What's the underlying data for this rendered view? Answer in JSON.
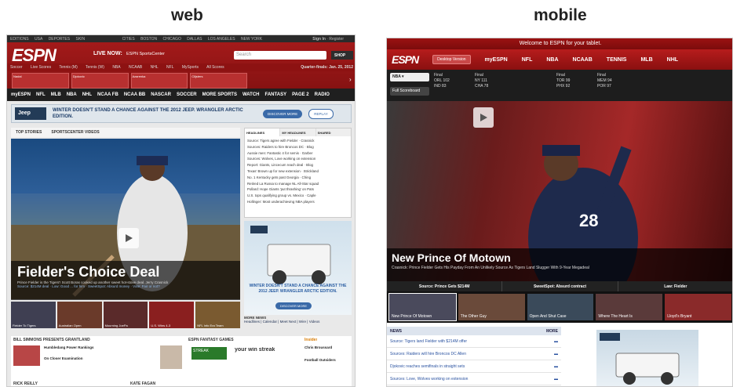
{
  "labels": {
    "web": "web",
    "mobile": "mobile"
  },
  "web": {
    "topbar": [
      "EDITIONS",
      "USA",
      "DEPORTES",
      "SKIN",
      "CITIES",
      "BOSTON",
      "CHICAGO",
      "DALLAS",
      "LOS ANGELES",
      "NEW YORK"
    ],
    "signin": "Sign In",
    "register": "Register",
    "logo": "ESPN",
    "live_now": "LIVE NOW:",
    "live_now_channel": "ESPN SportsCenter",
    "search_placeholder": "Search",
    "shop": "SHOP",
    "sports_nav": [
      "Soccer",
      "Live Scores",
      "Tennis (M)",
      "Tennis (W)",
      "NBA",
      "NCAAB",
      "NHL",
      "NFL",
      "MySports",
      "All Scores"
    ],
    "date": "Quarter-finals: Jan. 25, 2012",
    "score_cards": [
      "Nadal",
      "Djokovic",
      "Azarenka",
      "Clijsters"
    ],
    "main_nav": [
      "myESPN",
      "NFL",
      "MLB",
      "NBA",
      "NHL",
      "NCAA FB",
      "NCAA BB",
      "NASCAR",
      "SOCCER",
      "MORE SPORTS",
      "WATCH",
      "FANTASY",
      "PAGE 2",
      "RADIO"
    ],
    "ad": {
      "headline": "WINTER DOESN'T STAND A CHANCE AGAINST THE 2012 JEEP. WRANGLER ARCTIC EDITION.",
      "button": "DISCOVER MORE",
      "button2": "REPLAY"
    },
    "tabs": [
      "TOP STORIES",
      "SPORTSCENTER VIDEOS"
    ],
    "hero": {
      "title": "Fielder's Choice Deal",
      "sub": "Prince Fielder is the Tigers'! Scott Boras cooked up another sweet hot-stove deal. Jerry Crasnick",
      "links": "Source: $214M deal · Low: Good ... for him · SweetSpot: Absurd money · Vote: Fair or not?"
    },
    "thumbs": [
      "Fielder To Tigers",
      "Australian Open",
      "Mourning JoePa",
      "U.S. Wins 4-3",
      "NFL Info Era Team"
    ],
    "side_tabs": [
      "HEADLINES",
      "MY HEADLINES",
      "SHARED"
    ],
    "headlines": [
      "Source: Tigers agree with Fielder · Crasnick",
      "Sources: Raiders to hire Broncos DC · Blog",
      "Aussie men: Fantastic 4 for semis · Garber",
      "Sources: Wolves, Love working on extension",
      "Report: Giants, Lincecum reach deal · Blog",
      "Texas' Brown up for new extension · Strickland",
      "No. 1 Kentucky gets past Georgia · Ching",
      "Retired La Russa to manage NL All-Star squad",
      "Pollard: Hope Giants 'put thrashing' on Pats",
      "U.S. tops qualifying group vs. Mexico · Caple",
      "Hollinger: Most underachieving NBA players"
    ],
    "more_news": "MORE NEWS",
    "more_links": "Headlines | Calendar | Meet Next | Wire | Videos",
    "bottom": {
      "grantland": "BILL SIMMONS PRESENTS GRANTLAND",
      "g1": "Humbledang Power Rankings",
      "g2": "On Closer Examination",
      "fantasy": "ESPN FANTASY GAMES",
      "streak": "your win streak",
      "insider": "Insider",
      "i1": "Chris Broussard",
      "i2": "Football Outsiders",
      "kr": "RICK REILLY",
      "kf": "KATE FAGAN"
    }
  },
  "mobile": {
    "welcome": "Welcome to ESPN for your tablet.",
    "nav_desktop": "Desktop Version",
    "nav": [
      "myESPN",
      "NFL",
      "NBA",
      "NCAAB",
      "TENNIS",
      "MLB",
      "NHL"
    ],
    "league": "NBA",
    "full_scoreboard": "Full Scoreboard",
    "games": [
      [
        "Final",
        "ORL 102",
        "IND 83"
      ],
      [
        "Final",
        "NY 111",
        "CHA 78"
      ],
      [
        "Final",
        "TOR 99",
        "PHX 92"
      ],
      [
        "Final",
        "MEM 94",
        "POR 97"
      ]
    ],
    "hero": {
      "title": "New Prince Of Motown",
      "sub": "Crasnick: Prince Fielder Gets His Payday From An Unlikely Source As Tigers Land Slugger With 9-Year Megadeal"
    },
    "strip": [
      "Source: Prince Gets $214M",
      "SweetSpot: Absurd contract",
      "Law: Fielder"
    ],
    "thumbs": [
      "New Prince Of Motown",
      "The Other Guy",
      "Open And Shut Case",
      "Where The Heart Is",
      "Lloyd's Bryant"
    ],
    "news_header": "NEWS",
    "more": "MORE",
    "news": [
      "Source: Tigers land Fielder with $214M offer",
      "Sources: Raiders will hire Broncos DC Allen",
      "Djokovic reaches semifinals in straight sets",
      "Sources: Love, Wolves working on extension"
    ]
  }
}
